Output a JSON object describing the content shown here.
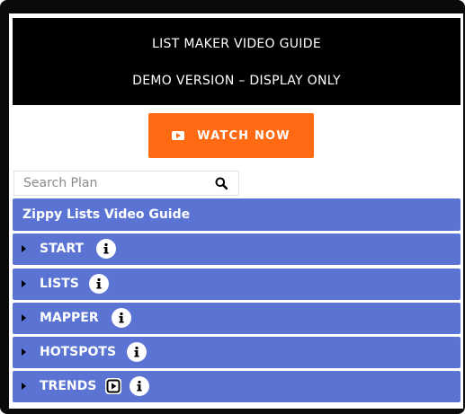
{
  "banner": {
    "line1": "LIST MAKER VIDEO GUIDE",
    "line2": "DEMO VERSION – DISPLAY ONLY"
  },
  "watch_button": {
    "label": "WATCH NOW",
    "icon": "youtube-play-icon"
  },
  "search": {
    "placeholder": "Search Plan",
    "value": "",
    "icon": "search-icon"
  },
  "guide": {
    "title": "Zippy Lists Video Guide",
    "items": [
      {
        "label": "START",
        "icons": [
          "info-icon"
        ]
      },
      {
        "label": "LISTS",
        "icons": [
          "info-icon"
        ]
      },
      {
        "label": "MAPPER",
        "icons": [
          "info-icon"
        ]
      },
      {
        "label": "HOTSPOTS",
        "icons": [
          "info-icon"
        ]
      },
      {
        "label": "TRENDS",
        "icons": [
          "video-play-icon",
          "info-icon"
        ]
      }
    ]
  },
  "colors": {
    "accent_orange": "#ff6a13",
    "accordion_blue": "#5b74d4",
    "banner_black": "#000000"
  }
}
